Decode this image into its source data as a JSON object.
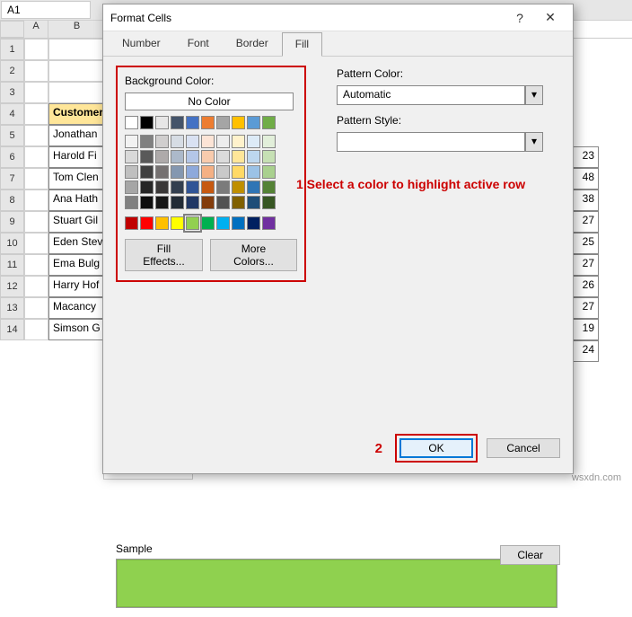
{
  "excel": {
    "cellref": "A1",
    "columns": [
      "A",
      "B"
    ],
    "table_header": "Customer",
    "rows": [
      {
        "n": 1,
        "name": ""
      },
      {
        "n": 2,
        "name": ""
      },
      {
        "n": 3,
        "name": ""
      },
      {
        "n": 4,
        "name": "Customer"
      },
      {
        "n": 5,
        "name": "Jonathan"
      },
      {
        "n": 6,
        "name": "Harold Fi"
      },
      {
        "n": 7,
        "name": "Tom Clen"
      },
      {
        "n": 8,
        "name": "Ana Hath"
      },
      {
        "n": 9,
        "name": "Stuart Gil"
      },
      {
        "n": 10,
        "name": "Eden Stev"
      },
      {
        "n": 11,
        "name": "Ema Bulg"
      },
      {
        "n": 12,
        "name": "Harry Hof"
      },
      {
        "n": 13,
        "name": "Macancy"
      },
      {
        "n": 14,
        "name": "Simson G"
      }
    ],
    "right_values": [
      "23",
      "48",
      "38",
      "27",
      "25",
      "27",
      "26",
      "27",
      "19",
      "24"
    ]
  },
  "dialog": {
    "title": "Format Cells",
    "help": "?",
    "close": "✕",
    "tabs": [
      "Number",
      "Font",
      "Border",
      "Fill"
    ],
    "active_tab": "Fill",
    "bg_label": "Background Color:",
    "no_color": "No Color",
    "fill_effects": "Fill Effects...",
    "more_colors": "More Colors...",
    "pattern_color_label": "Pattern Color:",
    "pattern_color_value": "Automatic",
    "pattern_style_label": "Pattern Style:",
    "sample_label": "Sample",
    "clear": "Clear",
    "ok": "OK",
    "cancel": "Cancel"
  },
  "annotations": {
    "step1": "1 Select a color to highlight active row",
    "step2": "2"
  },
  "colors": {
    "theme_row1": [
      "#ffffff",
      "#000000",
      "#e7e6e6",
      "#44546a",
      "#4472c4",
      "#ed7d31",
      "#a5a5a5",
      "#ffc000",
      "#5b9bd5",
      "#70ad47"
    ],
    "theme_row2": [
      "#f2f2f2",
      "#808080",
      "#d0cece",
      "#d6dce4",
      "#d9e1f2",
      "#fce4d6",
      "#ededed",
      "#fff2cc",
      "#ddebf7",
      "#e2efda"
    ],
    "theme_row3": [
      "#d9d9d9",
      "#595959",
      "#aeaaaa",
      "#acb9ca",
      "#b4c6e7",
      "#f8cbad",
      "#dbdbdb",
      "#ffe699",
      "#bdd7ee",
      "#c6e0b4"
    ],
    "theme_row4": [
      "#bfbfbf",
      "#404040",
      "#757171",
      "#8497b0",
      "#8ea9db",
      "#f4b084",
      "#c9c9c9",
      "#ffd966",
      "#9bc2e6",
      "#a9d08e"
    ],
    "theme_row5": [
      "#a6a6a6",
      "#262626",
      "#3a3838",
      "#333f4f",
      "#305496",
      "#c65911",
      "#7b7b7b",
      "#bf8f00",
      "#2f75b5",
      "#548235"
    ],
    "theme_row6": [
      "#808080",
      "#0d0d0d",
      "#161616",
      "#222b35",
      "#203764",
      "#833c0c",
      "#525252",
      "#806000",
      "#1f4e78",
      "#375623"
    ],
    "standard": [
      "#c00000",
      "#ff0000",
      "#ffc000",
      "#ffff00",
      "#92d050",
      "#00b050",
      "#00b0f0",
      "#0070c0",
      "#002060",
      "#7030a0"
    ],
    "selected": "#92d050",
    "sample": "#8fd14f"
  },
  "watermark": "wsxdn.com"
}
